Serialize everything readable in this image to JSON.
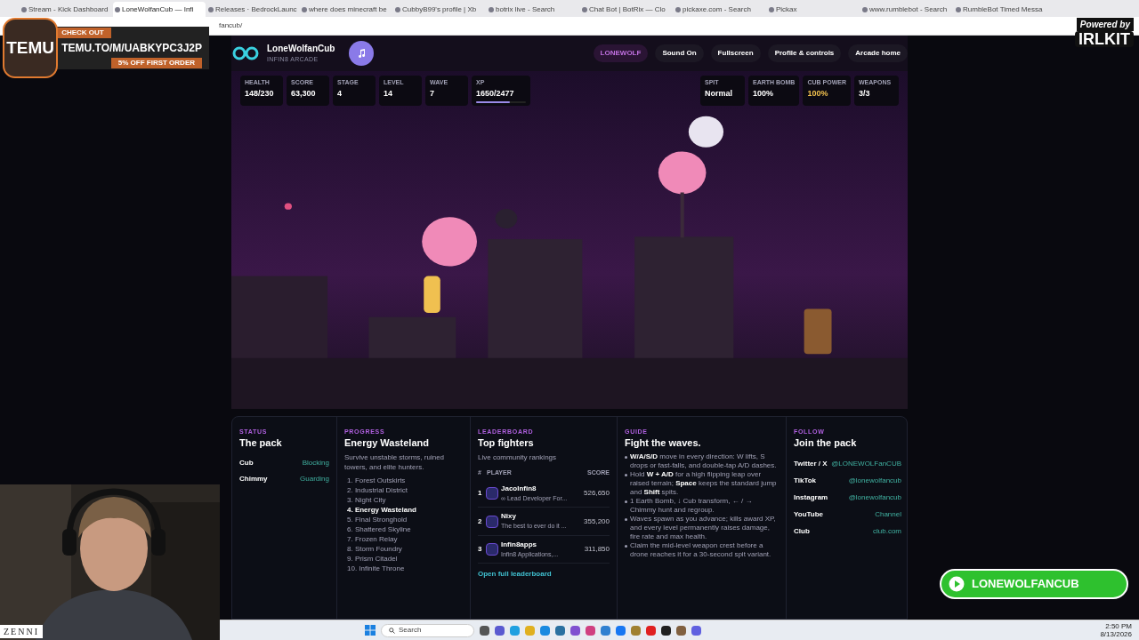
{
  "browser": {
    "tabs": [
      {
        "title": "Stream - Kick Dashboard",
        "selected": false
      },
      {
        "title": "LoneWolfanCub — Infi",
        "selected": true
      },
      {
        "title": "Releases · BedrockLaunc",
        "selected": false
      },
      {
        "title": "where does minecraft be",
        "selected": false
      },
      {
        "title": "CubbyB99's profile | Xb",
        "selected": false
      },
      {
        "title": "botrix live - Search",
        "selected": false
      },
      {
        "title": "Chat Bot | BotRix — Clo",
        "selected": false
      },
      {
        "title": "pickaxe.com - Search",
        "selected": false
      },
      {
        "title": "Pickax",
        "selected": false
      },
      {
        "title": "www.rumblebot - Search",
        "selected": false
      },
      {
        "title": "RumbleBot Timed Messa",
        "selected": false
      }
    ],
    "address": "fancub/"
  },
  "header": {
    "title": "LoneWolfanCub",
    "subtitle": "INFIN8 ARCADE",
    "badge": "LONEWOLF",
    "nav": [
      "Sound On",
      "Fullscreen",
      "Profile & controls",
      "Arcade home"
    ]
  },
  "stats_left": [
    {
      "label": "HEALTH",
      "value": "148/230",
      "kind": "plain"
    },
    {
      "label": "SCORE",
      "value": "63,300",
      "kind": "plain"
    },
    {
      "label": "STAGE",
      "value": "4",
      "kind": "plain"
    },
    {
      "label": "LEVEL",
      "value": "14",
      "kind": "plain"
    },
    {
      "label": "WAVE",
      "value": "7",
      "kind": "plain"
    },
    {
      "label": "XP",
      "value": "1650/2477",
      "kind": "bar",
      "level": 0.67
    }
  ],
  "stats_right": [
    {
      "label": "SPIT",
      "value": "Normal",
      "color": "#ffffff"
    },
    {
      "label": "EARTH BOMB",
      "value": "100%",
      "color": "#ffffff"
    },
    {
      "label": "CUB POWER",
      "value": "100%",
      "color": "#f2c14e"
    },
    {
      "label": "WEAPONS",
      "value": "3/3",
      "color": "#ffffff"
    }
  ],
  "status": {
    "eyebrow": "STATUS",
    "title": "The pack",
    "rows": [
      {
        "name": "Cub",
        "state": "Blocking"
      },
      {
        "name": "Chimmy",
        "state": "Guarding"
      }
    ]
  },
  "progress": {
    "eyebrow": "PROGRESS",
    "title": "Energy Wasteland",
    "text": "Survive unstable storms, ruined towers, and elite hunters.",
    "stages": [
      {
        "label": "1. Forest Outskirts",
        "selected": false
      },
      {
        "label": "2. Industrial District",
        "selected": false
      },
      {
        "label": "3. Night City",
        "selected": false
      },
      {
        "label": "4. Energy Wasteland",
        "selected": true
      },
      {
        "label": "5. Final Stronghold",
        "selected": false
      },
      {
        "label": "6. Shattered Skyline",
        "selected": false
      },
      {
        "label": "7. Frozen Relay",
        "selected": false
      },
      {
        "label": "8. Storm Foundry",
        "selected": false
      },
      {
        "label": "9. Prism Citadel",
        "selected": false
      },
      {
        "label": "10. Infinite Throne",
        "selected": false
      }
    ]
  },
  "leaderboard": {
    "eyebrow": "LEADERBOARD",
    "title": "Top fighters",
    "text": "Live community rankings",
    "columns": [
      "#",
      "PLAYER",
      "SCORE"
    ],
    "rows": [
      {
        "rank": "1",
        "name": "JacoInfin8",
        "note": "∞ Lead Developer For...",
        "score": "526,650"
      },
      {
        "rank": "2",
        "name": "Nixy",
        "note": "The best to ever do it ...",
        "score": "355,200"
      },
      {
        "rank": "3",
        "name": "Infin8apps",
        "note": "Infin8 Applications,...",
        "score": "311,850"
      }
    ],
    "link": "Open full leaderboard"
  },
  "guide": {
    "eyebrow": "GUIDE",
    "title": "Fight the waves.",
    "items": [
      "**W/A/S/D** move in every direction: W lifts, S drops or fast-falls, and double-tap A/D dashes.",
      "Hold **W + A/D** for a high flipping leap over raised terrain; **Space** keeps the standard jump and **Shift** spits.",
      "1 Earth Bomb, ↓ Cub transform, ← / → Chimmy hunt and regroup.",
      "Waves spawn as you advance; kills award XP, and every level permanently raises damage, fire rate and max health.",
      "Claim the mid-level weapon crest before a drone reaches it for a 30-second spit variant."
    ]
  },
  "follow": {
    "eyebrow": "FOLLOW",
    "title": "Join the pack",
    "links": [
      {
        "name": "Twitter / X",
        "value": "@LONEWOLFanCUB"
      },
      {
        "name": "TikTok",
        "value": "@lonewolfancub"
      },
      {
        "name": "Instagram",
        "value": "@lonewolfancub"
      },
      {
        "name": "YouTube",
        "value": "Channel"
      },
      {
        "name": "Club",
        "value": "club.com"
      }
    ]
  },
  "overlays": {
    "promo": {
      "logo": "TEMU",
      "kicker": "CHECK OUT",
      "code": "TEMU.TO/M/UABKYPC3J2P",
      "offer": "5% OFF FIRST ORDER"
    },
    "powered": {
      "label": "Powered by",
      "brand": "IRLKIT"
    },
    "sponsor": "ZENNI",
    "channel_button": "LONEWOLFANCUB"
  },
  "taskbar": {
    "search": "Search",
    "time": "2:50 PM",
    "date": "8/13/2026"
  }
}
